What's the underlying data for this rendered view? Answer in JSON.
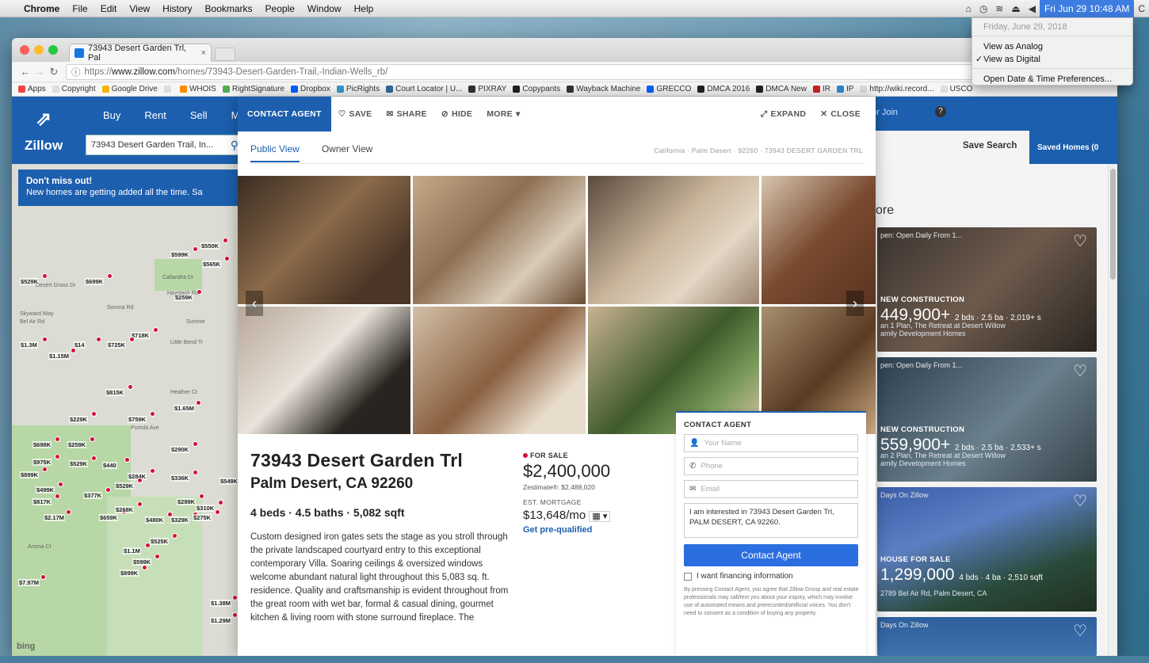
{
  "menubar": {
    "apple": "",
    "items": [
      "Chrome",
      "File",
      "Edit",
      "View",
      "History",
      "Bookmarks",
      "People",
      "Window",
      "Help"
    ],
    "clock": "Fri Jun 29  10:48 AM",
    "status_c": "C"
  },
  "clock_menu": {
    "date": "Friday, June 29, 2018",
    "analog": "View as Analog",
    "digital": "View as Digital",
    "check": "✓",
    "prefs": "Open Date & Time Preferences..."
  },
  "browser": {
    "tab_title": "73943 Desert Garden Trl, Pal",
    "tab_close": "×",
    "url_prefix": "https://",
    "url_domain": "www.zillow.com",
    "url_path": "/homes/73943-Desert-Garden-Trail,-Indian-Wells_rb/",
    "bookmarks": [
      "Apps",
      "Copyright",
      "Google Drive",
      "",
      "WHOIS",
      "RightSignature",
      "Dropbox",
      "PicRights",
      "Court Locator | U...",
      "PIXRAY",
      "Copypants",
      "Wayback Machine",
      "GRECCO",
      "DMCA 2016",
      "DMCA New",
      "IR",
      "IP",
      "http://wiki.record...",
      "USCO"
    ]
  },
  "zillow": {
    "logo": "Zillow",
    "nav": [
      "Buy",
      "Rent",
      "Sell",
      "Mc"
    ],
    "search_value": "73943 Desert Garden Trail, In...",
    "signin": "or Join",
    "save_search": "Save Search",
    "saved_homes": "Saved Homes (0",
    "banner_title": "Don't miss out!",
    "banner_text": "New homes are getting added all the time. Sa",
    "bing": "bing"
  },
  "map": {
    "price_labels": [
      "$550K",
      "$599K",
      "$565K",
      "$529K",
      "$699K",
      "$259K",
      "$718K",
      "$1.3M",
      "$14",
      "$725K",
      "$1.15M",
      "$815K",
      "$229K",
      "$759K",
      "$1.65M",
      "$698K",
      "$259K",
      "$975K",
      "$529K",
      "$440",
      "$290K",
      "$899K",
      "$284K",
      "$336K",
      "$499K",
      "$377K",
      "$529K",
      "$817K",
      "$2.17M",
      "$480K",
      "$329K",
      "$659K",
      "$525K",
      "$1.1M",
      "$599K",
      "$899K",
      "$7.97M",
      "$1.38M",
      "$1.29M",
      "$289K",
      "$310K",
      "$275K",
      "$549K",
      "$268K"
    ],
    "streets": [
      "Desert Grass Dr",
      "Sonora Rd",
      "Skyward Way",
      "Bel Air Rd",
      "Portola Ave",
      "Heather Ct",
      "Aroma Ct",
      "Callandra Dr",
      "Haystack Rd",
      "Sunrise",
      "Little Bend Tr"
    ]
  },
  "modal": {
    "contact_agent": "CONTACT AGENT",
    "save": "SAVE",
    "share": "SHARE",
    "hide": "HIDE",
    "more": "MORE",
    "expand": "EXPAND",
    "close": "CLOSE",
    "tab_public": "Public View",
    "tab_owner": "Owner View",
    "breadcrumb": "California · Palm Desert · 92260 · 73943 DESERT GARDEN TRL",
    "address_line1": "73943 Desert Garden Trl",
    "address_line2": "Palm Desert, CA 92260",
    "facts": "4 beds · 4.5 baths · 5,082 sqft",
    "description": "Custom designed iron gates sets the stage as you stroll through the private landscaped courtyard entry to this exceptional contemporary Villa. Soaring ceilings & oversized windows welcome abundant natural light throughout this 5,083 sq. ft. residence. Quality and craftsmanship is evident throughout from the great room with wet bar, formal & casual dining, gourmet kitchen & living room with stone surround fireplace. The",
    "for_sale": "FOR SALE",
    "price": "$2,400,000",
    "zestimate": "Zestimate®: $2,488,020",
    "est_mortgage_label": "EST. MORTGAGE",
    "est_mortgage": "$13,648/mo",
    "prequal": "Get pre-qualified"
  },
  "contact_form": {
    "title": "CONTACT AGENT",
    "name_placeholder": "Your Name",
    "phone_placeholder": "Phone",
    "email_placeholder": "Email",
    "message": "I am interested in 73943 Desert Garden Trl, PALM DESERT, CA 92260.",
    "button": "Contact Agent",
    "financing": "I want financing information",
    "legal": "By pressing Contact Agent, you agree that Zillow Group and real estate professionals may call/text you about your inquiry, which may involve use of automated means and prerecorded/artificial voices. You don't need to consent as a condition of buying any property."
  },
  "right_listings": {
    "heading": "ore",
    "cards": [
      {
        "tag": "pen: Open Daily From 1...",
        "kind": "NEW CONSTRUCTION",
        "price": "449,900+",
        "details": "2 bds · 2.5 ba · 2,019+ s",
        "sub": "an 1 Plan, The Retreat at Desert Willow",
        "sub2": "amily Development Homes"
      },
      {
        "tag": "pen: Open Daily From 1...",
        "kind": "NEW CONSTRUCTION",
        "price": "559,900+",
        "details": "2 bds · 2.5 ba · 2,533+ s",
        "sub": "an 2 Plan, The Retreat at Desert Willow",
        "sub2": "amily Development Homes"
      },
      {
        "tag": "Days On Zillow",
        "kind": "HOUSE FOR SALE",
        "price": "1,299,000",
        "details": "4 bds · 4 ba · 2,510 sqft",
        "sub": "2789 Bel Air Rd, Palm Desert, CA",
        "sub2": ""
      },
      {
        "tag": "Days On Zillow",
        "kind": "",
        "price": "",
        "details": "",
        "sub": "",
        "sub2": ""
      }
    ]
  },
  "colors": {
    "zillow_blue": "#1c5fae",
    "pin_red": "#d3113a",
    "button_blue": "#2b6ee0"
  }
}
